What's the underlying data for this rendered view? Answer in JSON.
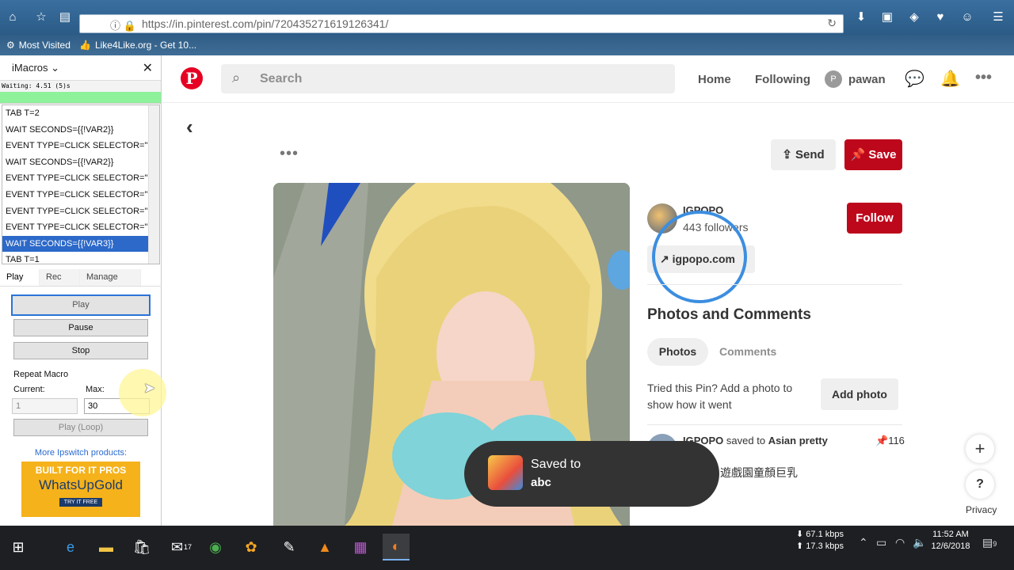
{
  "browser": {
    "url": "https://in.pinterest.com/pin/720435271619126341/",
    "bookmarks": [
      "Most Visited",
      "Like4Like.org - Get 10..."
    ]
  },
  "imacros": {
    "title": "iMacros",
    "status": "Waiting: 4.51 (5)s",
    "macro_lines": [
      "TAB T=2",
      "WAIT SECONDS={{!VAR2}}",
      "EVENT TYPE=CLICK SELECTOR=\"...",
      "WAIT SECONDS={{!VAR2}}",
      "EVENT TYPE=CLICK SELECTOR=\"...",
      "EVENT TYPE=CLICK SELECTOR=\"...",
      "EVENT TYPE=CLICK SELECTOR=\"...",
      "EVENT TYPE=CLICK SELECTOR=\"...",
      "WAIT SECONDS={{!VAR3}}",
      "TAB T=1"
    ],
    "selected_line_index": 8,
    "tabs": [
      "Play",
      "Rec",
      "Manage"
    ],
    "buttons": {
      "play": "Play",
      "pause": "Pause",
      "stop": "Stop",
      "play_loop": "Play (Loop)"
    },
    "repeat_label": "Repeat Macro",
    "current_label": "Current:",
    "max_label": "Max:",
    "current_value": "1",
    "max_value": "30",
    "more_products": "More Ipswitch products:",
    "ad": {
      "line1": "BUILT FOR IT PROS",
      "line2": "WhatsUpGold",
      "line3": "TRY IT FREE"
    }
  },
  "pinterest": {
    "search_placeholder": "Search",
    "nav": {
      "home": "Home",
      "following": "Following",
      "user_initial": "P",
      "user": "pawan"
    },
    "send": "Send",
    "save": "Save",
    "creator": {
      "name": "IGPOPO",
      "followers": "443 followers",
      "follow": "Follow",
      "site": "igpopo.com"
    },
    "section_title": "Photos and Comments",
    "pills": {
      "photos": "Photos",
      "comments": "Comments"
    },
    "tried_text": "Tried this Pin? Add a photo to show how it went",
    "add_photo": "Add photo",
    "activity": {
      "user": "IGPOPO",
      "action": "saved to",
      "board": "Asian pretty",
      "count": "116"
    },
    "description": "遊戲園童顏巨乳",
    "toast": {
      "line1": "Saved to",
      "board": "abc"
    },
    "privacy": "Privacy"
  },
  "taskbar": {
    "mail_badge": "17",
    "net_down": "67.1 kbps",
    "net_up": "17.3 kbps",
    "time": "11:52 AM",
    "date": "12/6/2018",
    "notif_count": "9"
  },
  "colors": {
    "pinterest_red": "#bd081c",
    "imacros_select": "#2c69c9",
    "progress_green": "#8ef29a"
  }
}
